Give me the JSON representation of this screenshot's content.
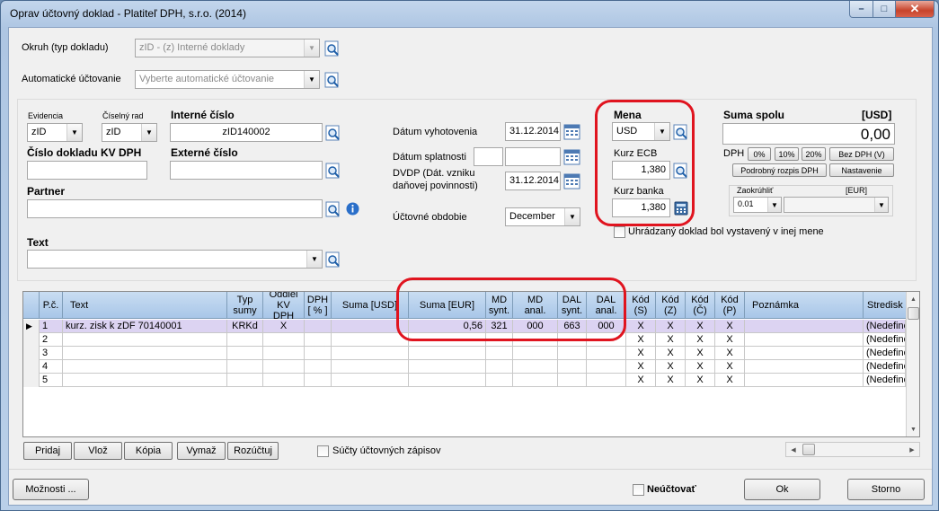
{
  "window": {
    "title": "Oprav účtovný doklad - Platiteľ DPH, s.r.o. (2014)",
    "min": "–",
    "max": "□",
    "close": "✕"
  },
  "top": {
    "okruh_label": "Okruh (typ dokladu)",
    "okruh_value": "zID - (z) Interné doklady",
    "auto_label": "Automatické účtovanie",
    "auto_placeholder": "Vyberte automatické účtovanie"
  },
  "left": {
    "evidencia_label": "Evidencia",
    "evidencia_value": "zID",
    "ciselny_rad_label": "Číselný rad",
    "ciselny_rad_value": "zID",
    "interne_cislo_label": "Interné číslo",
    "interne_cislo_value": "zID140002",
    "cislo_kv_label": "Číslo dokladu KV DPH",
    "cislo_kv_value": "",
    "externe_cislo_label": "Externé číslo",
    "externe_cislo_value": "",
    "partner_label": "Partner",
    "partner_value": "",
    "text_label": "Text",
    "text_value": ""
  },
  "dates": {
    "vyhotovenia_label": "Dátum vyhotovenia",
    "vyhotovenia_value": "31.12.2014",
    "splatnosti_label": "Dátum splatnosti",
    "splatnosti_value": "",
    "dvdp_label_1": "DVDP (Dát. vzniku",
    "dvdp_label_2": "daňovej povinnosti)",
    "dvdp_value": "31.12.2014",
    "obdobie_label": "Účtovné obdobie",
    "obdobie_value": "December"
  },
  "currency": {
    "mena_label": "Mena",
    "mena_value": "USD",
    "kurz_ecb_label": "Kurz ECB",
    "kurz_ecb_value": "1,380",
    "kurz_banka_label": "Kurz banka",
    "kurz_banka_value": "1,380",
    "inej_mene_label": "Uhrádzaný doklad bol vystavený v inej mene"
  },
  "sum": {
    "label": "Suma spolu",
    "unit": "[USD]",
    "value": "0,00",
    "dph_label": "DPH",
    "btn_0": "0%",
    "btn_10": "10%",
    "btn_20": "20%",
    "btn_bez": "Bez DPH (V)",
    "btn_rozpis": "Podrobný rozpis DPH",
    "btn_nastavenie": "Nastavenie",
    "zaokruhlit_label": "Zaokrúhliť",
    "eur_label": "[EUR]",
    "zaokruhlit_value": "0.01",
    "eur_value": ""
  },
  "grid": {
    "headers": {
      "pc": "P.č.",
      "text": "Text",
      "typ": "Typ sumy",
      "oddiel": "Oddiel KV DPH",
      "dph": "DPH [ % ]",
      "suma_usd": "Suma [USD]",
      "suma_eur": "Suma [EUR]",
      "md_synt": "MD synt.",
      "md_anal": "MD anal.",
      "dal_synt": "DAL synt.",
      "dal_anal": "DAL anal.",
      "kod_s": "Kód (S)",
      "kod_z": "Kód (Z)",
      "kod_c": "Kód (Č)",
      "kod_p": "Kód (P)",
      "poznamka": "Poznámka",
      "stredisko": "Stredisk"
    },
    "rows": [
      {
        "pc": "1",
        "text": "kurz. zisk k zDF 70140001",
        "typ": "KRKd",
        "oddiel": "X",
        "dph": "",
        "suma_usd": "",
        "suma_eur": "0,56",
        "md_synt": "321",
        "md_anal": "000",
        "dal_synt": "663",
        "dal_anal": "000",
        "kod_s": "X",
        "kod_z": "X",
        "kod_c": "X",
        "kod_p": "X",
        "poznamka": "",
        "stredisko": "(Nedefino"
      },
      {
        "pc": "2",
        "text": "",
        "typ": "",
        "oddiel": "",
        "dph": "",
        "suma_usd": "",
        "suma_eur": "",
        "md_synt": "",
        "md_anal": "",
        "dal_synt": "",
        "dal_anal": "",
        "kod_s": "X",
        "kod_z": "X",
        "kod_c": "X",
        "kod_p": "X",
        "poznamka": "",
        "stredisko": "(Nedefino"
      },
      {
        "pc": "3",
        "text": "",
        "typ": "",
        "oddiel": "",
        "dph": "",
        "suma_usd": "",
        "suma_eur": "",
        "md_synt": "",
        "md_anal": "",
        "dal_synt": "",
        "dal_anal": "",
        "kod_s": "X",
        "kod_z": "X",
        "kod_c": "X",
        "kod_p": "X",
        "poznamka": "",
        "stredisko": "(Nedefino"
      },
      {
        "pc": "4",
        "text": "",
        "typ": "",
        "oddiel": "",
        "dph": "",
        "suma_usd": "",
        "suma_eur": "",
        "md_synt": "",
        "md_anal": "",
        "dal_synt": "",
        "dal_anal": "",
        "kod_s": "X",
        "kod_z": "X",
        "kod_c": "X",
        "kod_p": "X",
        "poznamka": "",
        "stredisko": "(Nedefino"
      },
      {
        "pc": "5",
        "text": "",
        "typ": "",
        "oddiel": "",
        "dph": "",
        "suma_usd": "",
        "suma_eur": "",
        "md_synt": "",
        "md_anal": "",
        "dal_synt": "",
        "dal_anal": "",
        "kod_s": "X",
        "kod_z": "X",
        "kod_c": "X",
        "kod_p": "X",
        "poznamka": "",
        "stredisko": "(Nedefino"
      }
    ]
  },
  "grid_buttons": {
    "pridaj": "Pridaj",
    "vloz": "Vlož",
    "kopia": "Kópia",
    "vymaz": "Vymaž",
    "rozuctuj": "Rozúčtuj",
    "sucty_label": "Súčty účtovných zápisov"
  },
  "bottom": {
    "moznosti": "Možnosti ...",
    "neuctovat": "Neúčtovať",
    "ok": "Ok",
    "storno": "Storno"
  }
}
